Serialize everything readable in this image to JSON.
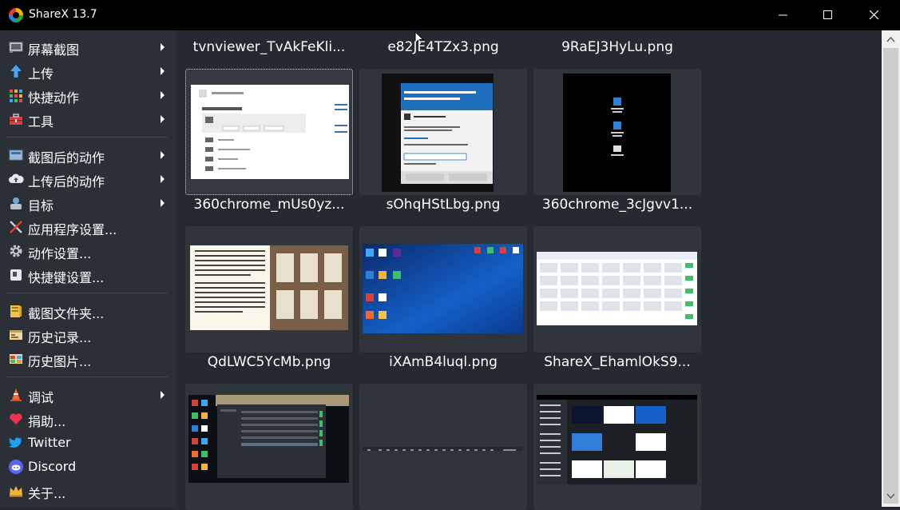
{
  "window": {
    "title": "ShareX 13.7",
    "controls": [
      "minimize",
      "maximize",
      "close"
    ]
  },
  "menu": {
    "groups": [
      [
        {
          "label": "屏幕截图",
          "icon": "screen-capture-icon",
          "submenu": true
        },
        {
          "label": "上传",
          "icon": "upload-arrow-icon",
          "submenu": true
        },
        {
          "label": "快捷动作",
          "icon": "grid-icon",
          "submenu": true
        },
        {
          "label": "工具",
          "icon": "toolbox-icon",
          "submenu": true
        }
      ],
      [
        {
          "label": "截图后的动作",
          "icon": "after-capture-icon",
          "submenu": true
        },
        {
          "label": "上传后的动作",
          "icon": "cloud-upload-icon",
          "submenu": true
        },
        {
          "label": "目标",
          "icon": "destination-icon",
          "submenu": true
        },
        {
          "label": "应用程序设置...",
          "icon": "wrench-screwdriver-icon",
          "submenu": false
        },
        {
          "label": "动作设置...",
          "icon": "gear-icon",
          "submenu": false
        },
        {
          "label": "快捷键设置...",
          "icon": "keyboard-key-icon",
          "submenu": false
        }
      ],
      [
        {
          "label": "截图文件夹...",
          "icon": "folder-icon",
          "submenu": false
        },
        {
          "label": "历史记录...",
          "icon": "history-icon",
          "submenu": false
        },
        {
          "label": "历史图片...",
          "icon": "image-history-icon",
          "submenu": false
        }
      ],
      [
        {
          "label": "调试",
          "icon": "traffic-cone-icon",
          "submenu": true
        },
        {
          "label": "捐助...",
          "icon": "heart-icon",
          "submenu": false
        },
        {
          "label": "Twitter",
          "icon": "twitter-icon",
          "submenu": false
        },
        {
          "label": "Discord",
          "icon": "discord-icon",
          "submenu": false
        },
        {
          "label": "关于...",
          "icon": "crown-icon",
          "submenu": false
        }
      ]
    ]
  },
  "thumbnails": [
    {
      "title": "tvnviewer_TvAkFeKli...",
      "selected": true,
      "preview": "printers-settings"
    },
    {
      "title": "e82JE4TZx3.png",
      "selected": false,
      "preview": "uac-dialog"
    },
    {
      "title": "9RaEJ3HyLu.png",
      "selected": false,
      "preview": "dark-icons"
    },
    {
      "title": "360chrome_mUs0yz...",
      "selected": false,
      "preview": "document-page"
    },
    {
      "title": "sOhqHStLbg.png",
      "selected": false,
      "preview": "blue-desktop"
    },
    {
      "title": "360chrome_3cJgvv1...",
      "selected": false,
      "preview": "table-grid"
    },
    {
      "title": "QdLWC5YcMb.png",
      "selected": false,
      "preview": "desktop-window"
    },
    {
      "title": "iXAmB4luql.png",
      "selected": false,
      "preview": "dark-taskbar"
    },
    {
      "title": "ShareX_EhamlOkS9...",
      "selected": false,
      "preview": "sharex-window"
    }
  ],
  "colors": {
    "titlebar": "#000000",
    "background": "#252a30",
    "menu": "#2b3036",
    "text": "#ffffff",
    "thumb_box": "#30353c"
  }
}
